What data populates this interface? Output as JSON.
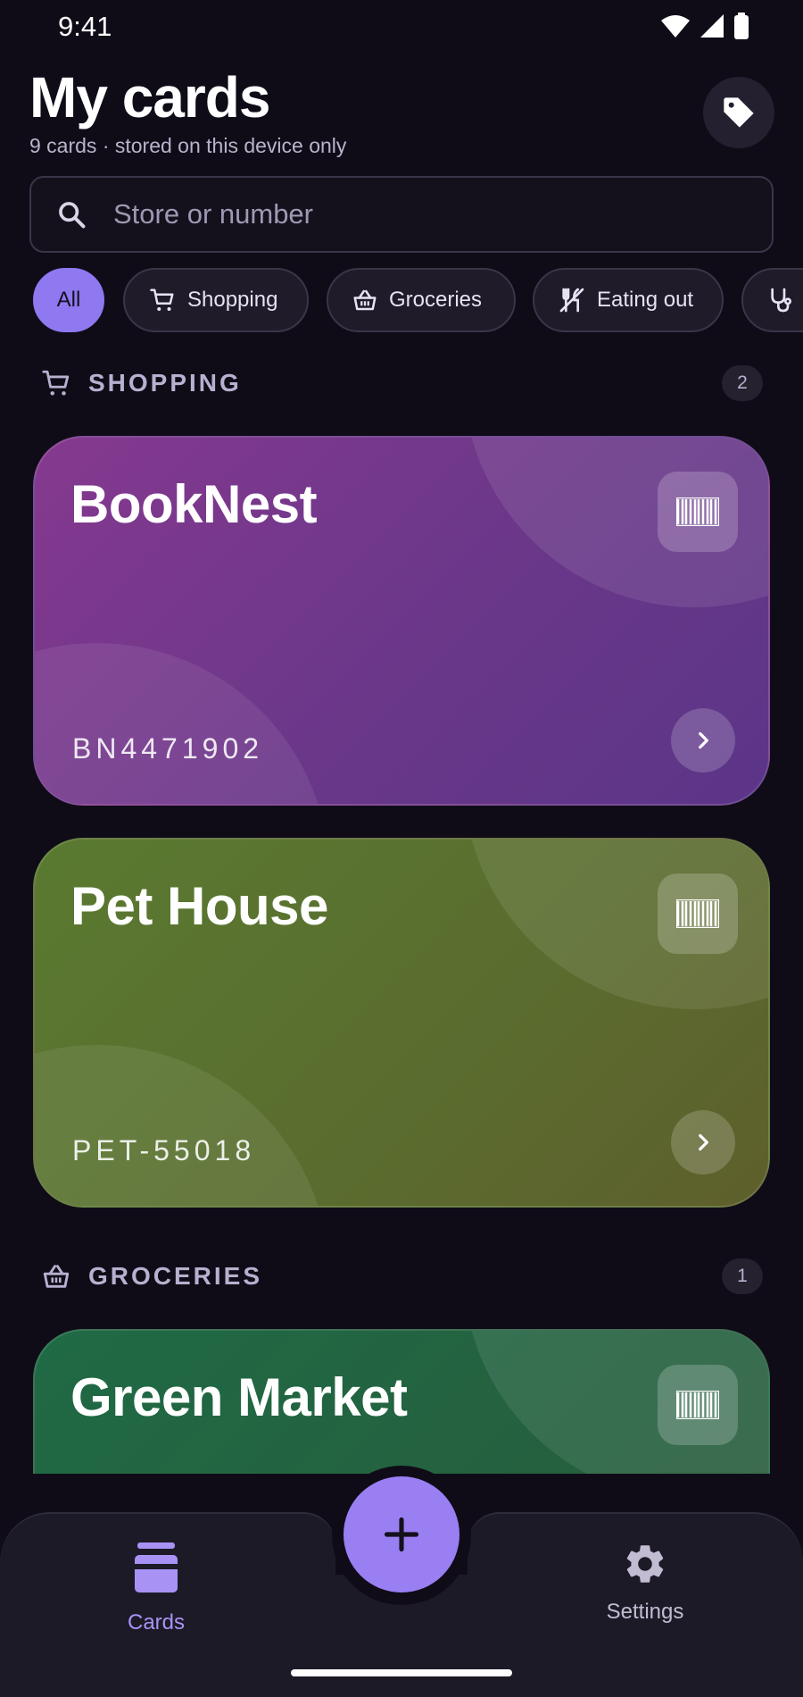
{
  "status_bar": {
    "time": "9:41"
  },
  "header": {
    "title": "My cards",
    "subtitle": "9 cards · stored on this device only"
  },
  "search": {
    "placeholder": "Store or number",
    "value": ""
  },
  "filters": [
    {
      "label": "All",
      "icon": "",
      "active": true
    },
    {
      "label": "Shopping",
      "icon": "cart-icon",
      "active": false
    },
    {
      "label": "Groceries",
      "icon": "basket-icon",
      "active": false
    },
    {
      "label": "Eating out",
      "icon": "utensils-off-icon",
      "active": false
    },
    {
      "label": "",
      "icon": "stethoscope-icon",
      "active": false
    }
  ],
  "sections": [
    {
      "title": "SHOPPING",
      "icon": "cart-icon",
      "count": "2",
      "cards": [
        {
          "name": "BookNest",
          "number": "BN4471902",
          "color": "#7a3a8e"
        },
        {
          "name": "Pet House",
          "number": "PET-55018",
          "color": "#5a7030"
        }
      ]
    },
    {
      "title": "GROCERIES",
      "icon": "basket-icon",
      "count": "1",
      "cards": [
        {
          "name": "Green Market",
          "number": "",
          "color": "#226642"
        }
      ]
    }
  ],
  "bottom_nav": {
    "cards_label": "Cards",
    "settings_label": "Settings",
    "add_icon": "plus-icon"
  },
  "colors": {
    "background": "#0f0c18",
    "accent": "#9a7ff3",
    "surface": "#1d1a27"
  }
}
